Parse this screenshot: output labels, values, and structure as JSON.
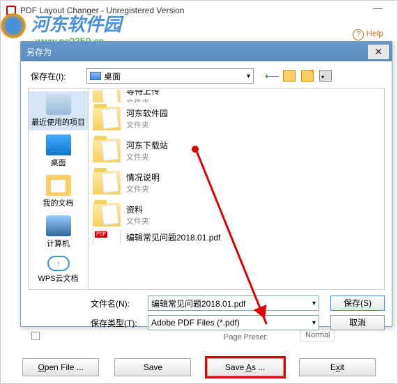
{
  "window": {
    "title": "PDF Layout Changer - Unregistered Version",
    "help": "Help"
  },
  "watermark": {
    "main": "河东软件园",
    "sub": "www.pc0359.cn"
  },
  "dialog": {
    "title": "另存为",
    "save_in_label": "保存在(I):",
    "save_in_value": "桌面",
    "sidebar": {
      "recent": "最近使用的项目",
      "desktop": "桌面",
      "documents": "我的文档",
      "computer": "计算机",
      "wps": "WPS云文档"
    },
    "files": [
      {
        "name": "等待上传",
        "type": "文件夹"
      },
      {
        "name": "河东软件园",
        "type": "文件夹"
      },
      {
        "name": "河东下载站",
        "type": "文件夹"
      },
      {
        "name": "情况说明",
        "type": "文件夹"
      },
      {
        "name": "资料",
        "type": "文件夹"
      },
      {
        "name": "编辑常见问题2018.01.pdf",
        "type": ""
      }
    ],
    "filename_label": "文件名(N):",
    "filename_value": "编辑常见问题2018.01.pdf",
    "filetype_label": "保存类型(T):",
    "filetype_value": "Adobe PDF Files (*.pdf)",
    "save_btn": "保存(S)",
    "cancel_btn": "取消"
  },
  "main_buttons": {
    "open": "Open File ...",
    "save": "Save",
    "saveas": "Save As ...",
    "exit": "Exit"
  },
  "footer": {
    "page": "Page Preset:",
    "normal": "Normal"
  }
}
